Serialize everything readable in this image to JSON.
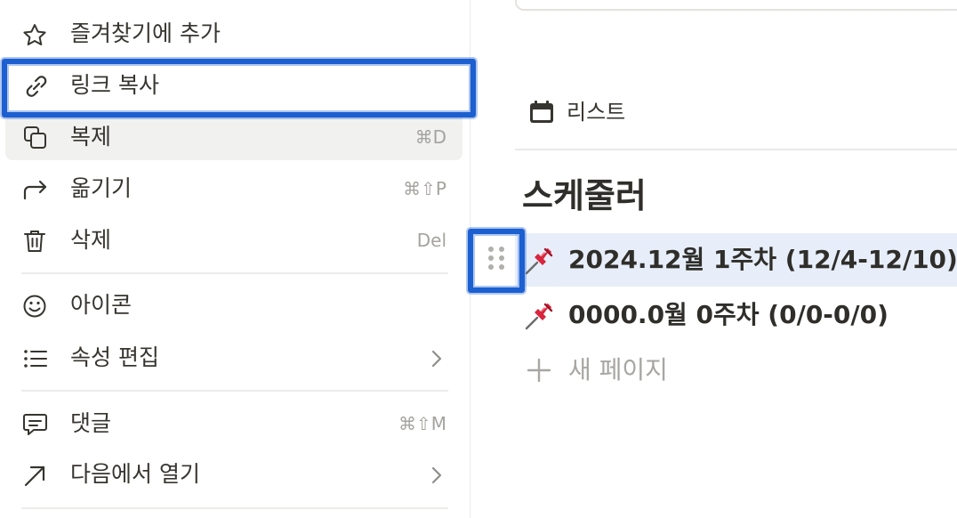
{
  "menu": {
    "items": [
      {
        "label": "즐겨찾기에 추가",
        "shortcut": "",
        "icon": "star-icon"
      },
      {
        "label": "링크 복사",
        "shortcut": "",
        "icon": "link-icon"
      },
      {
        "label": "복제",
        "shortcut": "⌘D",
        "icon": "duplicate-icon"
      },
      {
        "label": "옮기기",
        "shortcut": "⌘⇧P",
        "icon": "move-arrow-icon"
      },
      {
        "label": "삭제",
        "shortcut": "Del",
        "icon": "trash-icon"
      },
      {
        "label": "아이콘",
        "shortcut": "",
        "icon": "smiley-icon"
      },
      {
        "label": "속성 편집",
        "shortcut": "",
        "icon": "list-icon"
      },
      {
        "label": "댓글",
        "shortcut": "⌘⇧M",
        "icon": "comment-icon"
      },
      {
        "label": "다음에서 열기",
        "shortcut": "",
        "icon": "open-external-arrow-icon"
      }
    ]
  },
  "page": {
    "view_tab": "리스트",
    "group_title": "스케줄러",
    "rows": [
      {
        "title": "2024.12월 1주차 (12/4-12/10)",
        "icon": "pushpin-icon"
      },
      {
        "title": "0000.0월 0주차 (0/0-0/0)",
        "icon": "pushpin-icon"
      }
    ],
    "new_page_label": "새 페이지"
  },
  "colors": {
    "annotation": "#1c5fd0",
    "row_selected": "#e7eef9",
    "menu_hover": "#f1f1ef",
    "pin_red": "#d7263d"
  }
}
